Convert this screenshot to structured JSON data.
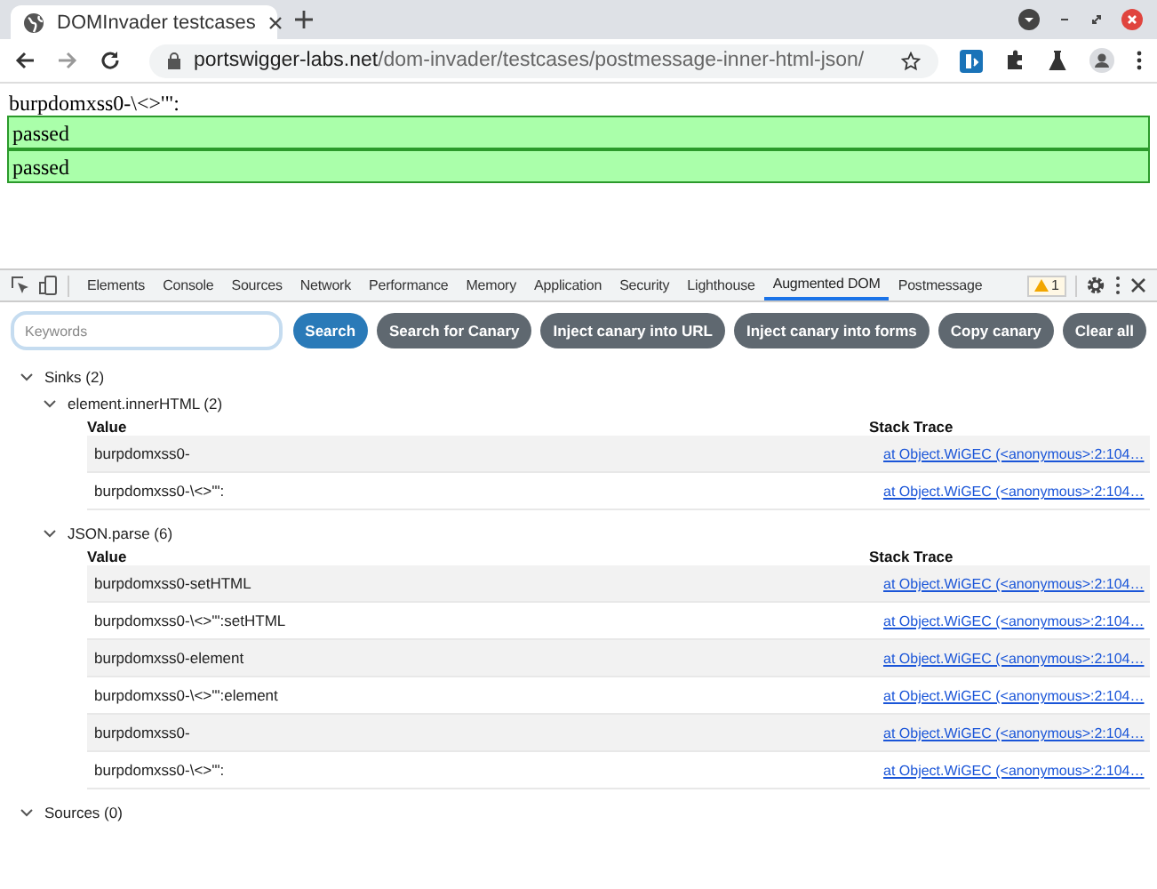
{
  "browser": {
    "tab_title": "DOMInvader testcases",
    "url_host": "portswigger-labs.net",
    "url_path": "/dom-invader/testcases/postmessage-inner-html-json/"
  },
  "page": {
    "heading": "burpdomxss0-\\<>'\":",
    "results": [
      {
        "text": "passed",
        "passed": true
      },
      {
        "text": "passed",
        "passed": true
      }
    ]
  },
  "devtools": {
    "tabs": [
      {
        "label": "Elements",
        "selected": false
      },
      {
        "label": "Console",
        "selected": false
      },
      {
        "label": "Sources",
        "selected": false
      },
      {
        "label": "Network",
        "selected": false
      },
      {
        "label": "Performance",
        "selected": false
      },
      {
        "label": "Memory",
        "selected": false
      },
      {
        "label": "Application",
        "selected": false
      },
      {
        "label": "Security",
        "selected": false
      },
      {
        "label": "Lighthouse",
        "selected": false
      },
      {
        "label": "Augmented DOM",
        "selected": true
      },
      {
        "label": "Postmessage",
        "selected": false
      }
    ],
    "warning_count": "1"
  },
  "toolbar": {
    "search": {
      "placeholder": "Keywords"
    },
    "buttons": [
      {
        "label": "Search",
        "kind": "primary"
      },
      {
        "label": "Search for Canary",
        "kind": "secondary"
      },
      {
        "label": "Inject canary into URL",
        "kind": "secondary"
      },
      {
        "label": "Inject canary into forms",
        "kind": "secondary"
      },
      {
        "label": "Copy canary",
        "kind": "secondary"
      },
      {
        "label": "Clear all",
        "kind": "secondary"
      }
    ]
  },
  "tree": [
    {
      "label": "Sinks (2)",
      "expanded": true,
      "children": [
        {
          "label": "element.innerHTML (2)",
          "expanded": true,
          "table": {
            "columns": [
              "Value",
              "Stack Trace"
            ],
            "rows": [
              [
                "burpdomxss0-",
                "at Object.WiGEC (<anonymous>:2:104…"
              ],
              [
                "burpdomxss0-\\<>'\":",
                "at Object.WiGEC (<anonymous>:2:104…"
              ]
            ]
          }
        },
        {
          "label": "JSON.parse (6)",
          "expanded": true,
          "table": {
            "columns": [
              "Value",
              "Stack Trace"
            ],
            "rows": [
              [
                "burpdomxss0-setHTML",
                "at Object.WiGEC (<anonymous>:2:104…"
              ],
              [
                "burpdomxss0-\\<>'\":setHTML",
                "at Object.WiGEC (<anonymous>:2:104…"
              ],
              [
                "burpdomxss0-element",
                "at Object.WiGEC (<anonymous>:2:104…"
              ],
              [
                "burpdomxss0-\\<>'\":element",
                "at Object.WiGEC (<anonymous>:2:104…"
              ],
              [
                "burpdomxss0-",
                "at Object.WiGEC (<anonymous>:2:104…"
              ],
              [
                "burpdomxss0-\\<>'\":",
                "at Object.WiGEC (<anonymous>:2:104…"
              ]
            ]
          }
        }
      ]
    },
    {
      "label": "Sources (0)",
      "expanded": true
    }
  ]
}
